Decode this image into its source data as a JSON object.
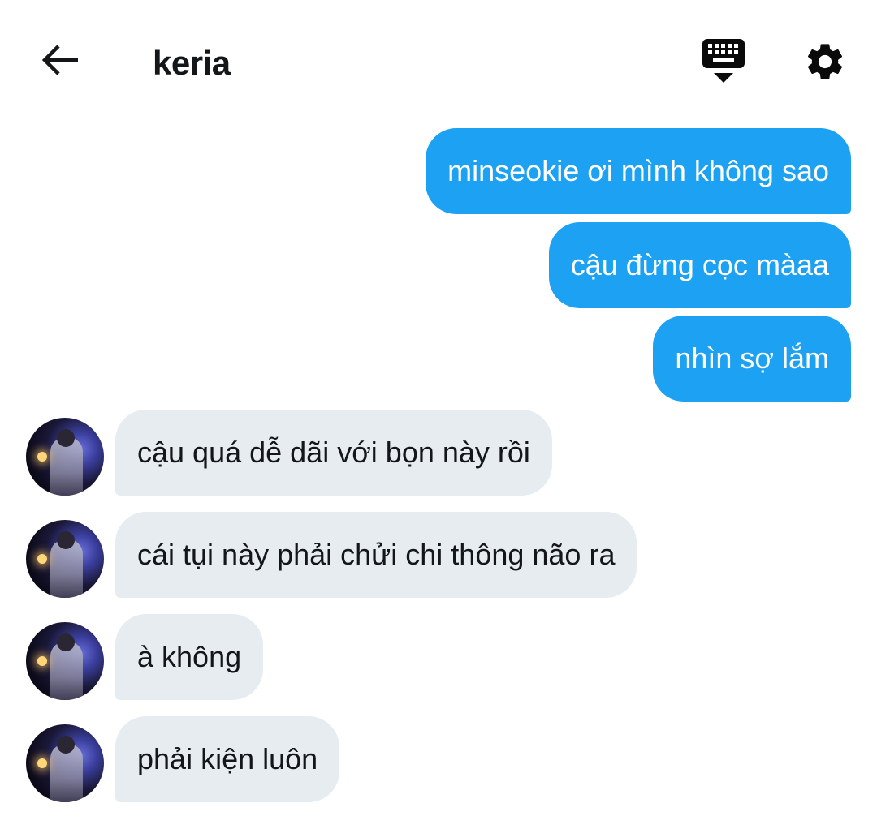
{
  "header": {
    "title": "keria",
    "back_icon": "arrow-left-icon",
    "keyboard_icon": "keyboard-hide-icon",
    "settings_icon": "gear-icon"
  },
  "colors": {
    "sent_bubble": "#1da1f2",
    "received_bubble": "#e6ecf0",
    "text_dark": "#14171a"
  },
  "messages": [
    {
      "direction": "sent",
      "text": "minseokie ơi mình không sao"
    },
    {
      "direction": "sent",
      "text": "cậu đừng cọc màaa"
    },
    {
      "direction": "sent",
      "text": "nhìn sợ lắm"
    },
    {
      "direction": "received",
      "text": "cậu quá dễ dãi với bọn này rồi"
    },
    {
      "direction": "received",
      "text": "cái tụi này phải chửi chi thông não ra"
    },
    {
      "direction": "received",
      "text": "à không"
    },
    {
      "direction": "received",
      "text": "phải kiện luôn"
    }
  ]
}
